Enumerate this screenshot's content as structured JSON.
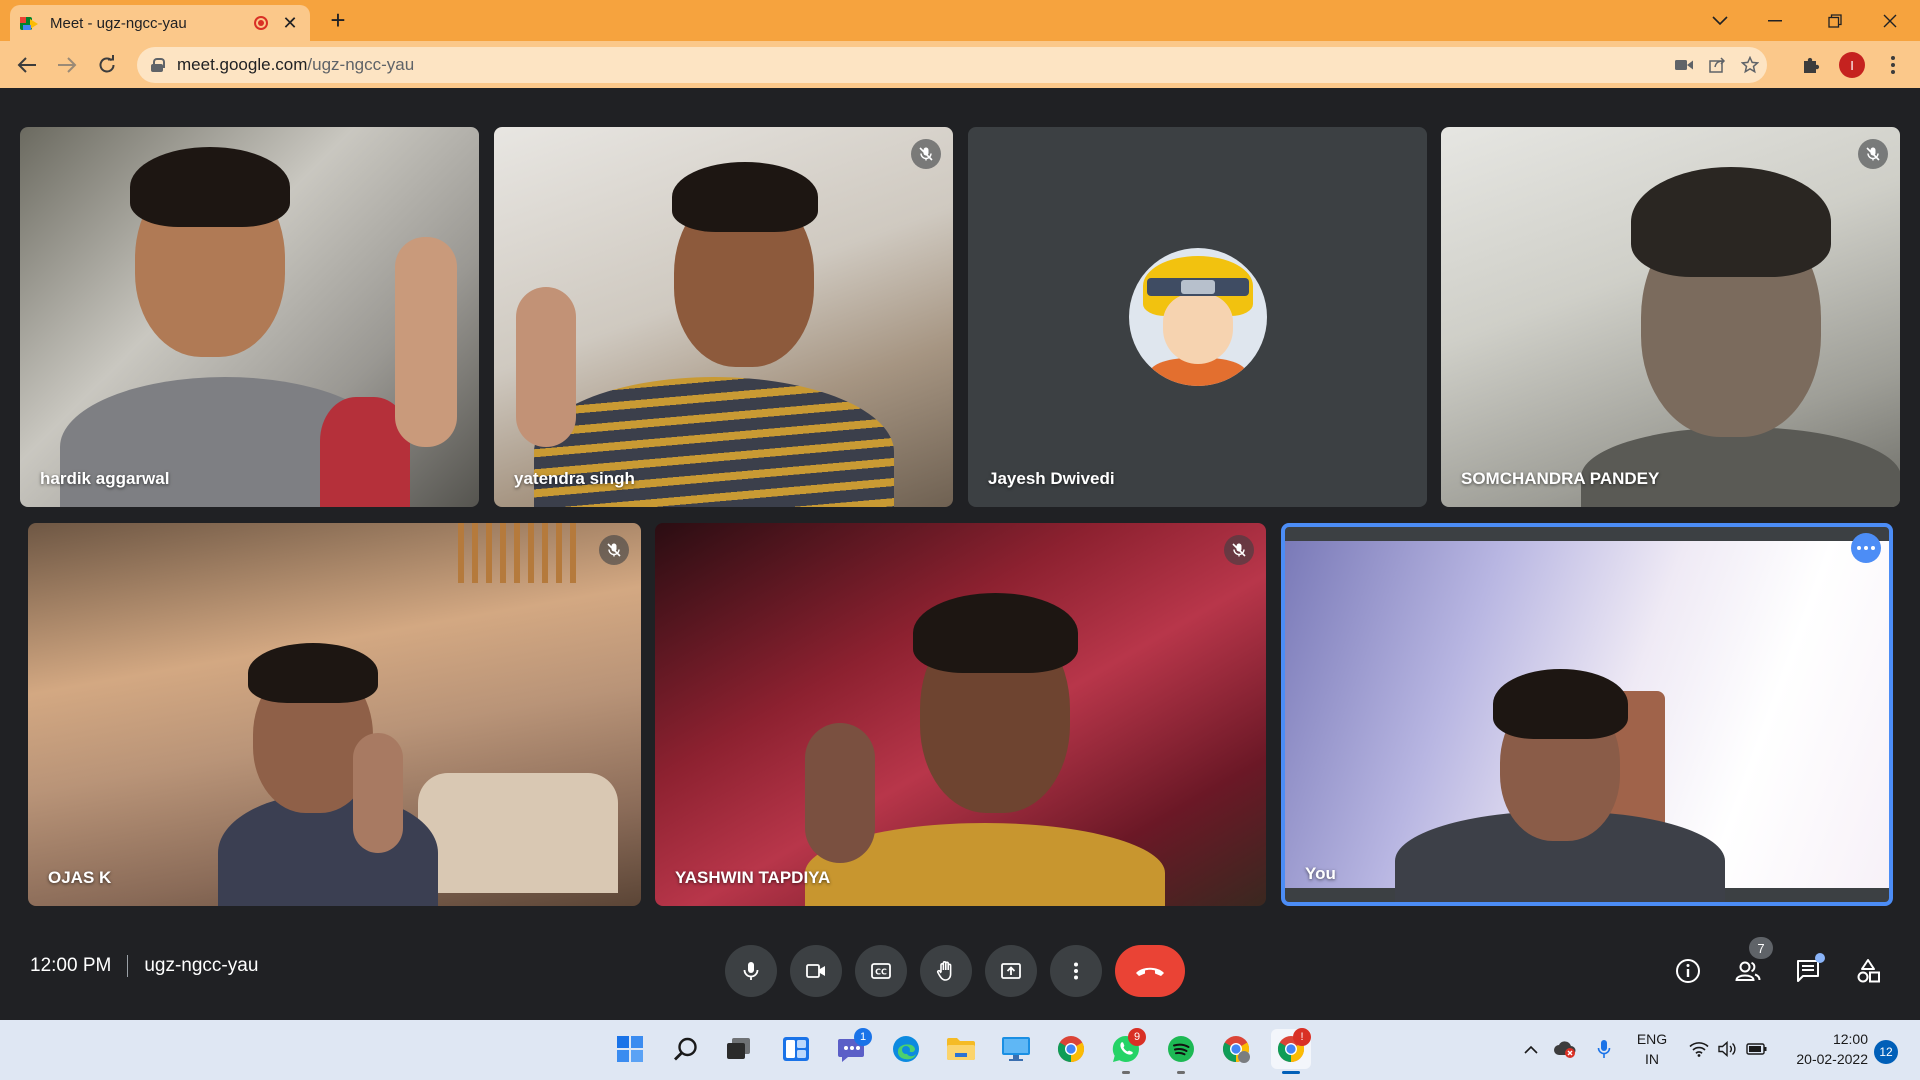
{
  "browser": {
    "tab_title": "Meet - ugz-ngcc-yau",
    "tab_close": "✕",
    "new_tab": "+",
    "url_host": "meet.google.com",
    "url_path": "/ugz-ngcc-yau",
    "profile_initial": "I",
    "window_controls": [
      "chevron-down",
      "minimize",
      "restore",
      "close"
    ]
  },
  "participants": [
    {
      "name": "hardik aggarwal",
      "muted": false
    },
    {
      "name": "yatendra singh",
      "muted": true
    },
    {
      "name": "Jayesh Dwivedi",
      "muted": false,
      "camera_off": true
    },
    {
      "name": "SOMCHANDRA PANDEY",
      "muted": true
    },
    {
      "name": "OJAS K",
      "muted": true
    },
    {
      "name": "YASHWIN TAPDIYA",
      "muted": true
    },
    {
      "name": "You",
      "self": true
    }
  ],
  "meeting": {
    "time": "12:00 PM",
    "code": "ugz-ngcc-yau",
    "participant_count": "7"
  },
  "controls": [
    "microphone",
    "camera",
    "captions",
    "raise-hand",
    "present-screen",
    "more-options",
    "leave-call"
  ],
  "right_controls": [
    "meeting-details",
    "people",
    "chat",
    "activities"
  ],
  "taskbar": {
    "apps": [
      "start",
      "search",
      "task-view",
      "widgets",
      "teams-chat",
      "edge",
      "file-explorer",
      "this-pc",
      "chrome",
      "whatsapp",
      "spotify",
      "chrome-profile",
      "chrome-active"
    ],
    "teams_badge": "1",
    "whatsapp_badge": "9",
    "chrome_badge": "!",
    "language": "ENG",
    "region": "IN",
    "clock_time": "12:00",
    "clock_date": "20-02-2022",
    "notifications": "12"
  },
  "colors": {
    "tab_bar": "#f6a33e",
    "toolbar": "#fbc88a",
    "meet_background": "#202124",
    "end_call": "#ea4335",
    "active_speaker_border": "#4c8df6"
  }
}
